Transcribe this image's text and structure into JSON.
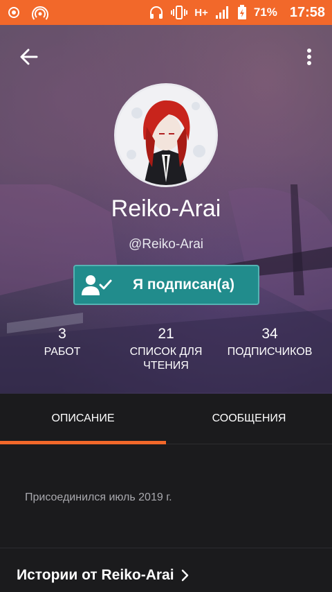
{
  "status_bar": {
    "battery_percent": "71%",
    "time": "17:58",
    "network": "H+",
    "icons": [
      "camera-icon",
      "hotspot-icon",
      "headphones-icon",
      "vibrate-icon",
      "signal-icon",
      "battery-charging-icon"
    ],
    "bg_color": "#f2682a"
  },
  "profile": {
    "username": "Reiko-Arai",
    "handle": "@Reiko-Arai",
    "follow_label": "Я подписан(а)"
  },
  "stats": [
    {
      "value": "3",
      "label": "РАБОТ"
    },
    {
      "value": "21",
      "label": "СПИСОК ДЛЯ ЧТЕНИЯ"
    },
    {
      "value": "34",
      "label": "ПОДПИСЧИКОВ"
    }
  ],
  "tabs": [
    {
      "label": "ОПИСАНИЕ",
      "active": true
    },
    {
      "label": "СООБЩЕНИЯ",
      "active": false
    }
  ],
  "description": {
    "joined": "Присоединился июль 2019 г."
  },
  "stories": {
    "title": "Истории от Reiko-Arai"
  },
  "colors": {
    "accent": "#f2682a",
    "follow_button": "#218c8c",
    "background": "#1b1b1d"
  }
}
